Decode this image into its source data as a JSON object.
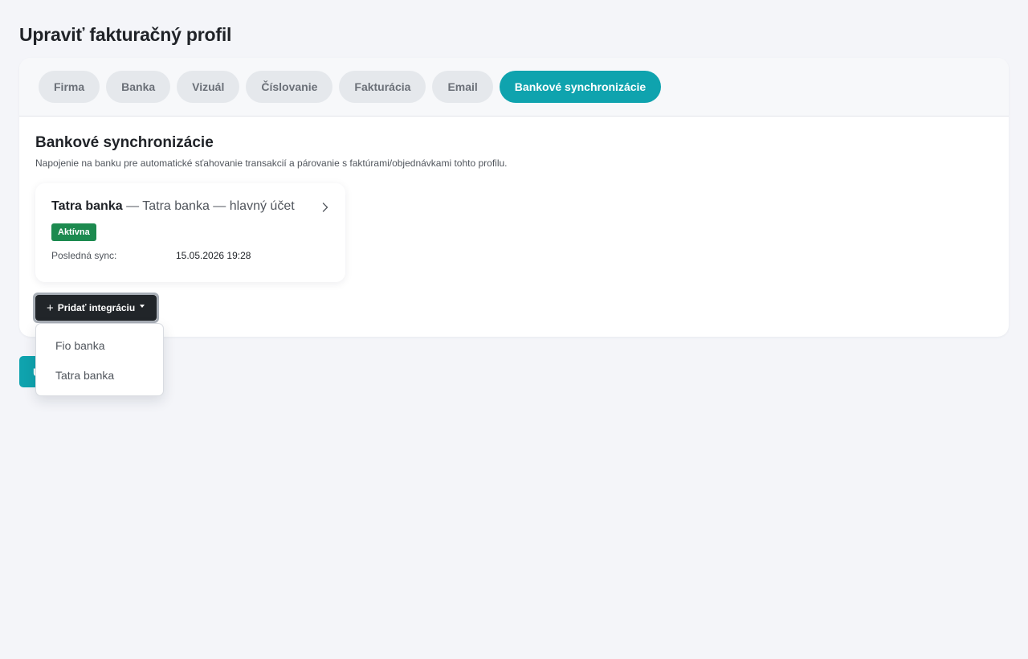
{
  "page": {
    "title": "Upraviť fakturačný profil"
  },
  "tabs": [
    {
      "label": "Firma",
      "active": false
    },
    {
      "label": "Banka",
      "active": false
    },
    {
      "label": "Vizuál",
      "active": false
    },
    {
      "label": "Číslovanie",
      "active": false
    },
    {
      "label": "Fakturácia",
      "active": false
    },
    {
      "label": "Email",
      "active": false
    },
    {
      "label": "Bankové synchronizácie",
      "active": true
    }
  ],
  "section": {
    "title": "Bankové synchronizácie",
    "description": "Napojenie na banku pre automatické sťahovanie transakcií a párovanie s faktúrami/objednávkami tohto profilu."
  },
  "integration": {
    "bank": "Tatra banka",
    "name_suffix": " — Tatra banka — hlavný účet",
    "status": "Aktívna",
    "last_sync_label": "Posledná sync:",
    "last_sync_value": "15.05.2026 19:28",
    "chevron_icon": "chevron-right-icon"
  },
  "add_button": {
    "plus_icon": "+",
    "label": "Pridať integráciu"
  },
  "dropdown": {
    "items": [
      {
        "label": "Fio banka"
      },
      {
        "label": "Tatra banka"
      }
    ]
  },
  "save_button": {
    "label": "Uložiť"
  },
  "colors": {
    "accent": "#0fa3ae",
    "status_active": "#1c8a4f",
    "dark_button": "#212529",
    "background": "#f4f5f9"
  }
}
